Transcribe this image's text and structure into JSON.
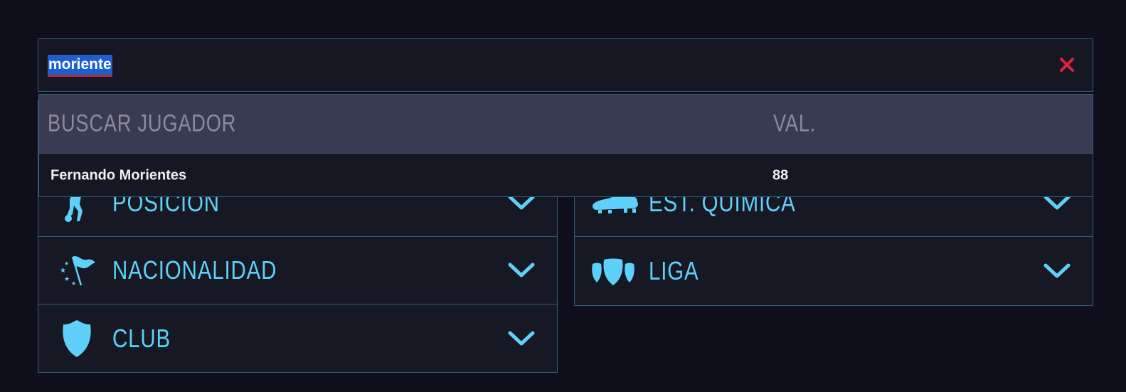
{
  "search": {
    "value": "moriente",
    "clear_icon": "close-icon"
  },
  "results": {
    "header_name": "BUSCAR JUGADOR",
    "header_value": "VAL.",
    "rows": [
      {
        "name": "Fernando Morientes",
        "value": "88"
      }
    ]
  },
  "filters": {
    "left": [
      {
        "label": "POSICIÓN",
        "icon": "player-position-icon"
      },
      {
        "label": "NACIONALIDAD",
        "icon": "flag-icon"
      },
      {
        "label": "CLUB",
        "icon": "shield-icon"
      }
    ],
    "right": [
      {
        "label": "EST. QUÍMICA",
        "icon": "boot-icon"
      },
      {
        "label": "LIGA",
        "icon": "league-icon"
      }
    ]
  },
  "colors": {
    "accent": "#5ed0fa",
    "background": "#0e0f1a",
    "panel": "#161824",
    "border": "#2f5f78",
    "header": "#393a54",
    "clear": "#e0203c",
    "selection": "#1e5fd0"
  }
}
